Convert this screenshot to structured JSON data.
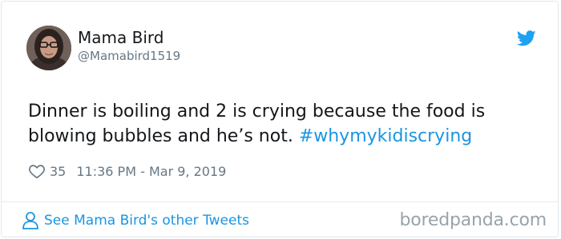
{
  "tweet": {
    "author": {
      "display_name": "Mama Bird",
      "handle": "@Mamabird1519",
      "avatar_icon": "profile-photo"
    },
    "text_parts": {
      "line_1": "Dinner is boiling and 2 is crying because the food is",
      "line_2_plain": "blowing bubbles and he’s not. ",
      "hashtag": "#whymykidiscrying"
    },
    "like_count": "35",
    "timestamp": "11:36 PM - Mar 9, 2019"
  },
  "footer": {
    "link_label": "See Mama Bird's other Tweets",
    "watermark": "boredpanda.com"
  },
  "colors": {
    "accent": "#1b95e0",
    "secondary_text": "#657786",
    "border": "#e1e8ed"
  },
  "icons": {
    "brand": "twitter-bird-icon",
    "like": "heart-outline-icon",
    "profile_link": "person-icon"
  }
}
